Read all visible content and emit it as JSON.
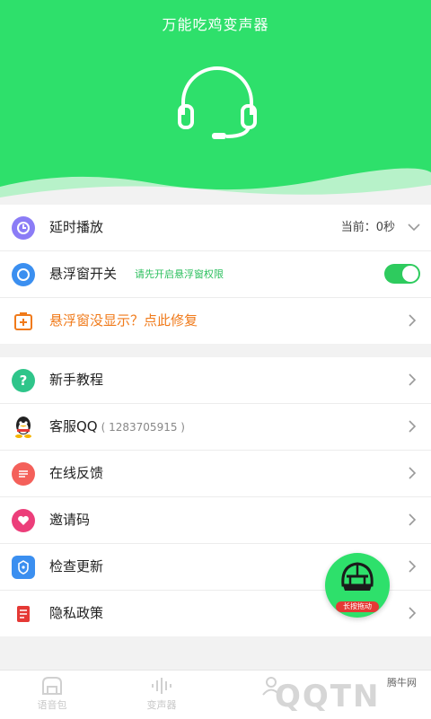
{
  "header": {
    "title": "万能吃鸡变声器"
  },
  "section1": {
    "delay": {
      "label": "延时播放",
      "current": "当前：0秒"
    },
    "float": {
      "label": "悬浮窗开关",
      "hint": "请先开启悬浮窗权限",
      "toggle_on": true
    },
    "fix": {
      "label": "悬浮窗没显示？点此修复"
    }
  },
  "section2": {
    "tutorial": {
      "label": "新手教程"
    },
    "service": {
      "label": "客服QQ",
      "qq": "( 1283705915 )"
    },
    "feedback": {
      "label": "在线反馈"
    },
    "invite": {
      "label": "邀请码"
    },
    "update": {
      "label": "检查更新"
    },
    "privacy": {
      "label": "隐私政策"
    }
  },
  "float_button": {
    "tag": "长按拖动"
  },
  "tabs": [
    {
      "label": "语音包"
    },
    {
      "label": "变声器"
    }
  ],
  "watermark": {
    "text": "QQTN",
    "small": "腾牛网"
  },
  "colors": {
    "accent": "#2ee06b",
    "orange": "#f07a1a",
    "toggle": "#2ecb5e"
  }
}
